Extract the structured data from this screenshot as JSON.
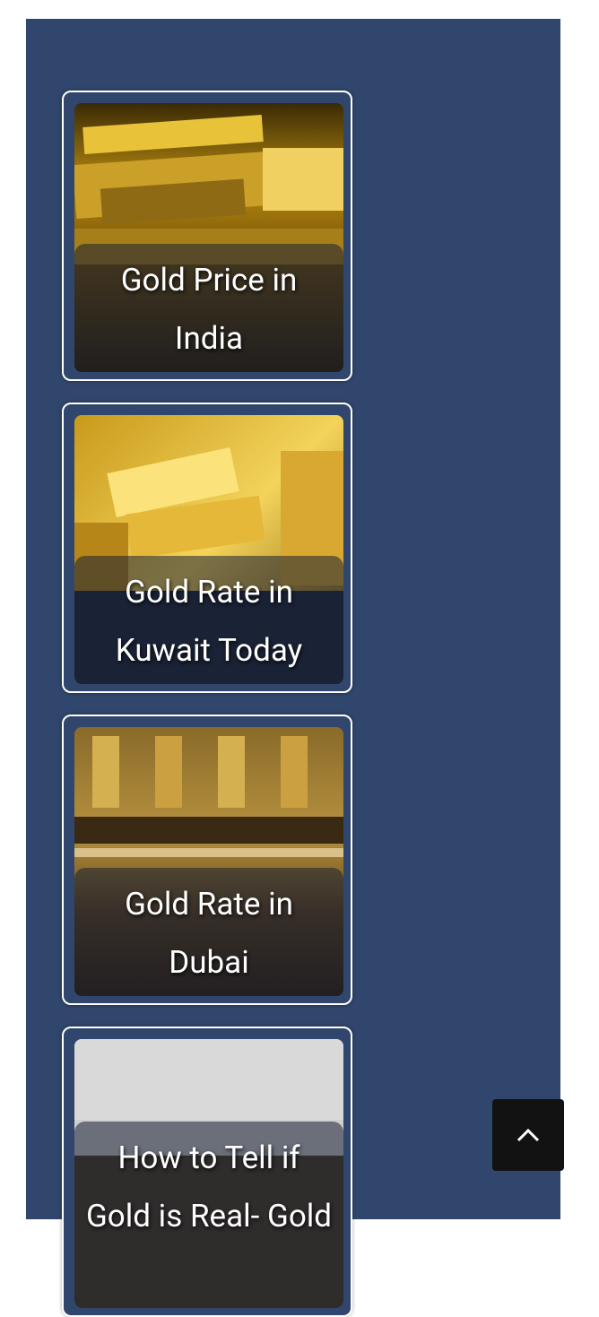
{
  "cards": [
    {
      "title_line1": "Gold Price in",
      "title_line2": "India",
      "image": "gold-bars-stack"
    },
    {
      "title_line1": "Gold Rate in",
      "title_line2": "Kuwait Today",
      "image": "gold-bars-pile"
    },
    {
      "title_line1": "Gold Rate in",
      "title_line2": "Dubai",
      "image": "jewellery-shop-window"
    },
    {
      "title_line1": "How to Tell if",
      "title_line2": "Gold is Real- Gold",
      "image": "fake-vs-real-graphic"
    }
  ],
  "scroll_top": {
    "icon": "chevron-up-icon"
  }
}
